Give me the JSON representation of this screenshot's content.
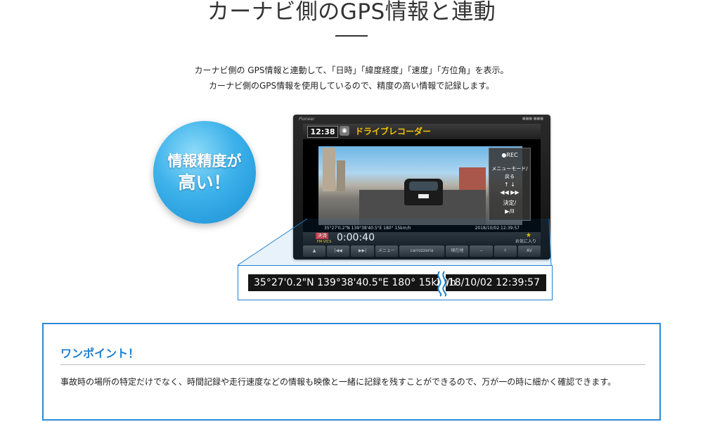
{
  "header": {
    "title": "カーナビ側のGPS情報と連動"
  },
  "intro": {
    "line1": "カーナビ側の GPS情報と連動して、「日時」「緯度経度」「速度」「方位角」を表示。",
    "line2": "カーナビ側のGPS情報を使用しているので、精度の高い情報で記録します。"
  },
  "badge": {
    "line1": "情報精度が",
    "line2": "高い！"
  },
  "device": {
    "brand": "Pioneer",
    "clock": "12:38",
    "app_title": "ドライブレコーダー",
    "side_panel": {
      "rec": "●REC",
      "menu": "メニューモード/戻る",
      "confirm": "決定/",
      "play": "▶/II"
    },
    "gps_overlay_left": "35°27'0.2\"N 139°38'40.5\"E 180° 15km/h",
    "gps_overlay_right": "2018/10/02 12:39:57",
    "status": {
      "timer": "0:00:40",
      "payment_badge": "決済",
      "favorite": "お気に入り"
    },
    "buttons": [
      "▲",
      "|◀◀",
      "▶▶|",
      "メニュー",
      "carrozzeria",
      "現在地",
      "−",
      "＋",
      "AV"
    ]
  },
  "zoom": {
    "left_text": "35°27'0.2\"N 139°38'40.5\"E 180° 15km/h",
    "right_text": "2018/10/02 12:39:57"
  },
  "one_point": {
    "title": "ワンポイント！",
    "body": "事故時の場所の特定だけでなく、時間記録や走行速度などの情報も映像と一緒に記録を残すことができるので、万が一の時に細かく確認できます。"
  },
  "colors": {
    "accent_blue": "#1f7fcf",
    "badge_blue": "#3cb1ea",
    "app_title_yellow": "#f2c200"
  }
}
